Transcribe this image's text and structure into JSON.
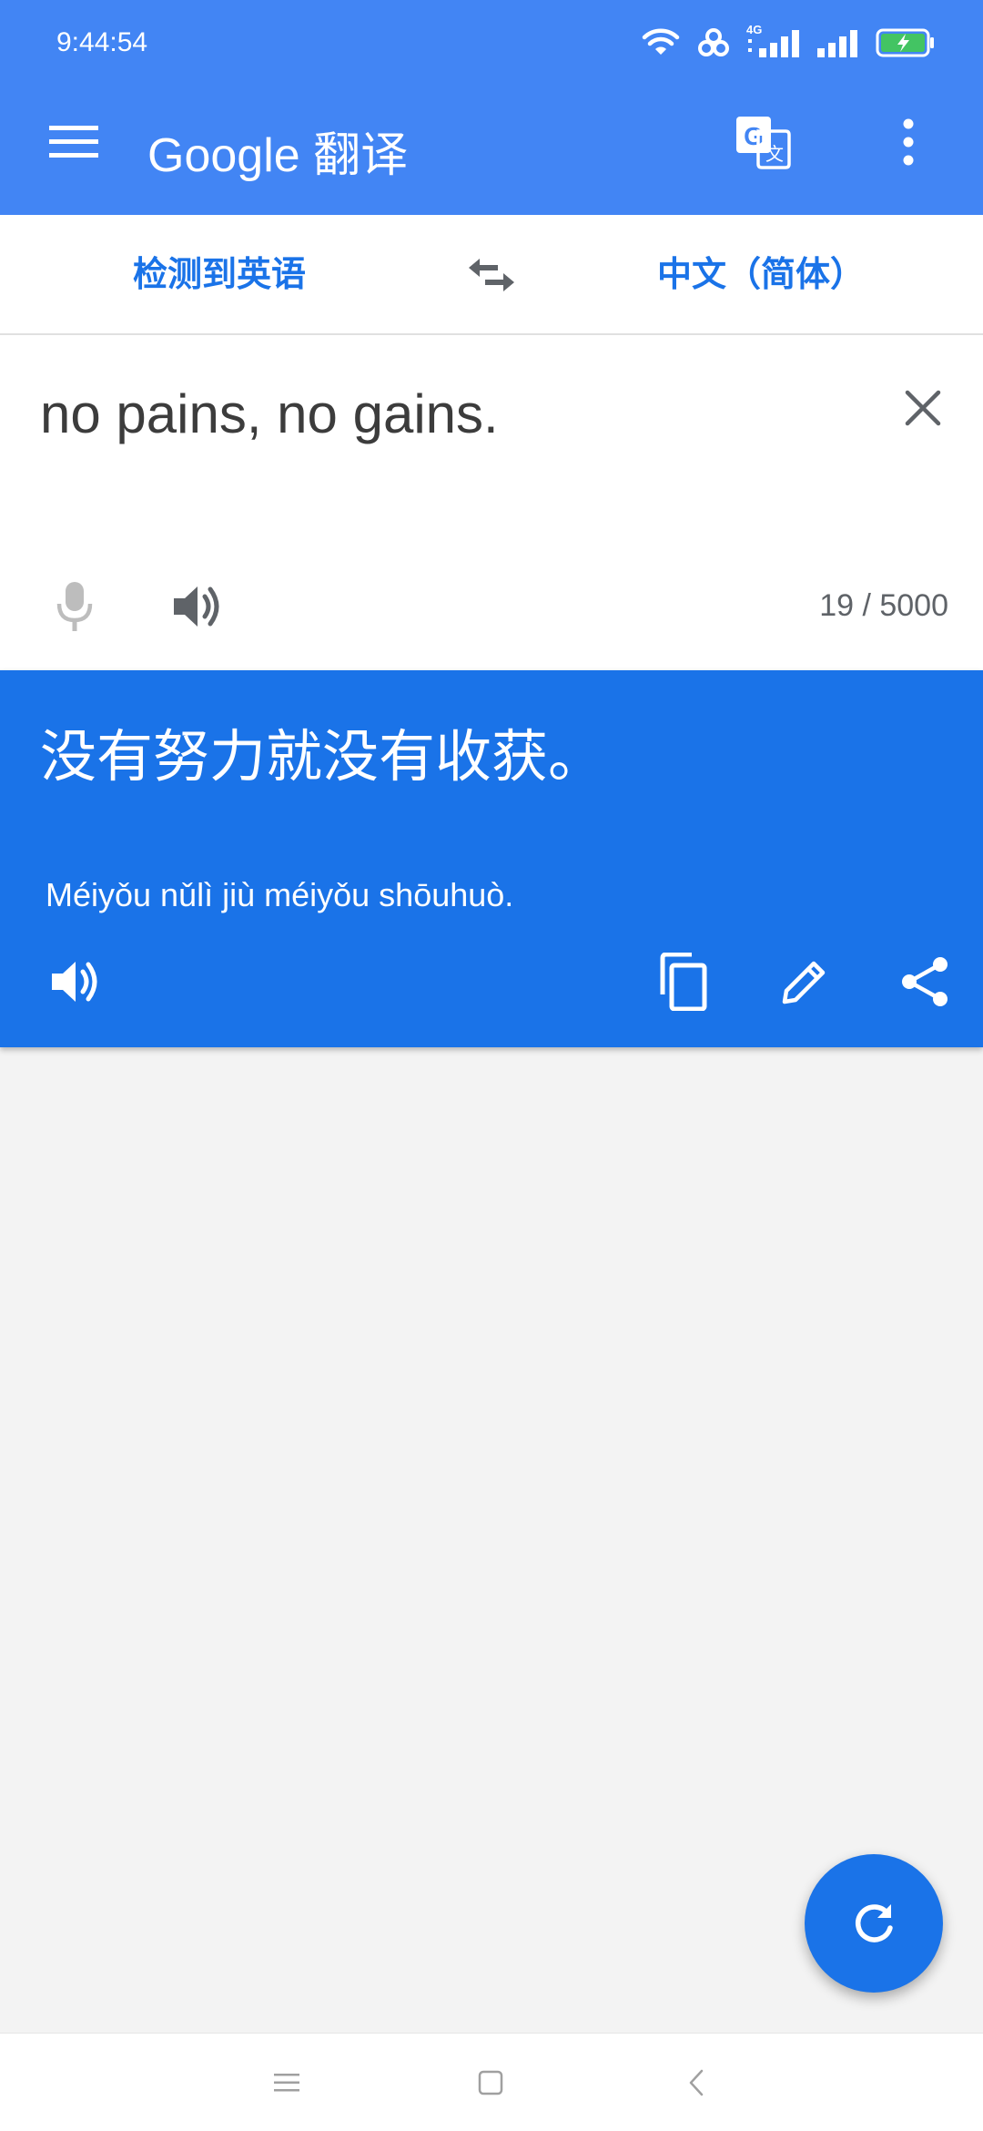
{
  "status_bar": {
    "time": "9:44:54",
    "network_label": "4G"
  },
  "app_bar": {
    "title": "Google 翻译",
    "icons": [
      "menu-icon",
      "translate-icon",
      "more-vert-icon"
    ]
  },
  "language_bar": {
    "source": "检测到英语",
    "target": "中文（简体）",
    "swap_icon": "swap-horiz-icon"
  },
  "input": {
    "text": "no pains, no gains.",
    "char_count": "19 / 5000",
    "icons": [
      "mic-icon",
      "volume-icon",
      "close-icon"
    ]
  },
  "output": {
    "translation": "没有努力就没有收获。",
    "pinyin": "Méiyǒu nǔlì jiù méiyǒu shōuhuò.",
    "icons": [
      "volume-icon",
      "copy-icon",
      "edit-icon",
      "share-icon"
    ]
  },
  "fab": {
    "icon": "refresh-icon"
  },
  "colors": {
    "app_bar": "#4285f4",
    "accent": "#1a73e8",
    "background": "#f3f3f3"
  }
}
